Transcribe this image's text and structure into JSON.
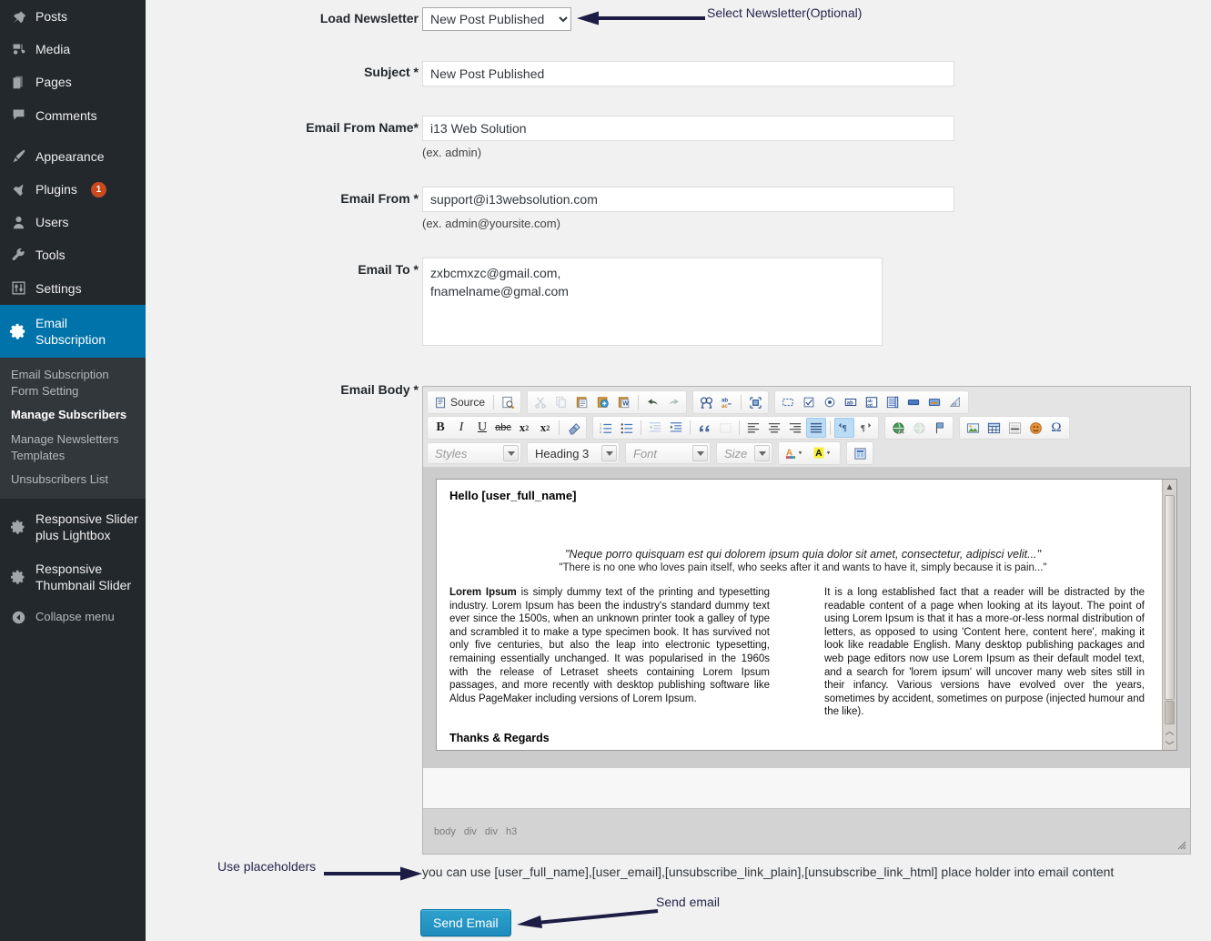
{
  "sidebar": {
    "items": [
      {
        "label": "Posts",
        "icon": "pin-icon"
      },
      {
        "label": "Media",
        "icon": "media-icon"
      },
      {
        "label": "Pages",
        "icon": "pages-icon"
      },
      {
        "label": "Comments",
        "icon": "comments-icon"
      },
      {
        "label": "Appearance",
        "icon": "brush-icon"
      },
      {
        "label": "Plugins",
        "icon": "plug-icon",
        "badge": "1"
      },
      {
        "label": "Users",
        "icon": "user-icon"
      },
      {
        "label": "Tools",
        "icon": "wrench-icon"
      },
      {
        "label": "Settings",
        "icon": "sliders-icon"
      },
      {
        "label": "Email\nSubscription",
        "icon": "gear-icon",
        "current": true
      }
    ],
    "submenu": [
      {
        "label": "Email Subscription\nForm Setting",
        "current": false
      },
      {
        "label": "Manage Subscribers",
        "current": true
      },
      {
        "label": "Manage Newsletters\nTemplates",
        "current": false
      },
      {
        "label": "Unsubscribers List",
        "current": false
      }
    ],
    "plugins_after": [
      {
        "label": "Responsive Slider\nplus Lightbox",
        "icon": "gear-icon"
      },
      {
        "label": "Responsive\nThumbnail Slider",
        "icon": "gear-icon"
      }
    ],
    "collapse": {
      "label": "Collapse menu",
      "icon": "collapse-icon"
    }
  },
  "form": {
    "load_newsletter": {
      "label": "Load Newsletter",
      "value": "New Post Published",
      "options": [
        "New Post Published"
      ]
    },
    "subject": {
      "label": "Subject *",
      "value": "New Post Published"
    },
    "email_from_name": {
      "label": "Email From Name*",
      "value": "i13 Web Solution",
      "hint": "(ex. admin)"
    },
    "email_from": {
      "label": "Email From *",
      "value": "support@i13websolution.com",
      "hint": "(ex. admin@yoursite.com)"
    },
    "email_to": {
      "label": "Email To *",
      "value": "zxbcmxzc@gmail.com,\nfnamelname@gmal.com"
    },
    "email_body": {
      "label": "Email Body *"
    }
  },
  "editor": {
    "toolbar_row1": [
      [
        {
          "name": "source-button",
          "label": "Source",
          "type": "text-btn"
        },
        {
          "name": "preview-icon",
          "label": "Preview"
        }
      ],
      [
        {
          "name": "cut-icon",
          "label": "Cut",
          "disabled": true
        },
        {
          "name": "copy-icon",
          "label": "Copy",
          "disabled": true
        },
        {
          "name": "paste-icon",
          "label": "Paste"
        },
        {
          "name": "paste-text-icon",
          "label": "Paste as plain text"
        },
        {
          "name": "paste-from-word-icon",
          "label": "Paste from Word"
        },
        {
          "name": "undo-icon",
          "label": "Undo"
        },
        {
          "name": "redo-icon",
          "label": "Redo",
          "disabled": true
        }
      ],
      [
        {
          "name": "find-icon",
          "label": "Find"
        },
        {
          "name": "replace-icon",
          "label": "Replace"
        },
        {
          "name": "select-all-icon",
          "label": "Select All"
        }
      ],
      [
        {
          "name": "form-icon",
          "label": "Form"
        },
        {
          "name": "checkbox-icon",
          "label": "Checkbox"
        },
        {
          "name": "radio-button-icon",
          "label": "Radio Button"
        },
        {
          "name": "text-field-icon",
          "label": "Text Field"
        },
        {
          "name": "textarea-icon",
          "label": "Textarea"
        },
        {
          "name": "select-field-icon",
          "label": "Selection Field"
        },
        {
          "name": "button-icon",
          "label": "Button"
        },
        {
          "name": "image-button-icon",
          "label": "Image Button"
        },
        {
          "name": "hidden-field-icon",
          "label": "Hidden Field"
        }
      ]
    ],
    "toolbar_row2": [
      [
        {
          "name": "bold-icon",
          "label": "Bold"
        },
        {
          "name": "italic-icon",
          "label": "Italic"
        },
        {
          "name": "underline-icon",
          "label": "Underline"
        },
        {
          "name": "strikethrough-icon",
          "label": "Strike Through"
        },
        {
          "name": "subscript-icon",
          "label": "Subscript"
        },
        {
          "name": "superscript-icon",
          "label": "Superscript"
        },
        {
          "name": "remove-format-icon",
          "label": "Remove Format"
        }
      ],
      [
        {
          "name": "numbered-list-icon",
          "label": "Insert/Remove Numbered List"
        },
        {
          "name": "bulleted-list-icon",
          "label": "Insert/Remove Bulleted List"
        },
        {
          "name": "outdent-icon",
          "label": "Decrease Indent",
          "disabled": true
        },
        {
          "name": "indent-icon",
          "label": "Increase Indent"
        },
        {
          "name": "blockquote-icon",
          "label": "Block Quote"
        },
        {
          "name": "create-div-icon",
          "label": "Create Div Container",
          "disabled": true
        },
        {
          "name": "align-left-icon",
          "label": "Align Left"
        },
        {
          "name": "align-center-icon",
          "label": "Center"
        },
        {
          "name": "align-right-icon",
          "label": "Align Right"
        },
        {
          "name": "justify-icon",
          "label": "Justify",
          "active": true
        },
        {
          "name": "text-direction-ltr-icon",
          "label": "Text direction left to right",
          "active": true
        },
        {
          "name": "text-direction-rtl-icon",
          "label": "Text direction right to left"
        }
      ],
      [
        {
          "name": "link-icon",
          "label": "Link"
        },
        {
          "name": "unlink-icon",
          "label": "Unlink",
          "disabled": true
        },
        {
          "name": "anchor-icon",
          "label": "Anchor"
        }
      ],
      [
        {
          "name": "image-icon",
          "label": "Image"
        },
        {
          "name": "table-icon",
          "label": "Table"
        },
        {
          "name": "horizontal-rule-icon",
          "label": "Horizontal Line"
        },
        {
          "name": "smiley-icon",
          "label": "Smiley"
        },
        {
          "name": "special-char-icon",
          "label": "Insert Special Character"
        }
      ]
    ],
    "combos": [
      {
        "name": "styles-combo",
        "label": "Styles",
        "placeholder": true
      },
      {
        "name": "format-combo",
        "label": "Heading 3",
        "placeholder": false
      },
      {
        "name": "font-combo",
        "label": "Font",
        "placeholder": true
      },
      {
        "name": "size-combo",
        "label": "Size",
        "placeholder": true
      }
    ],
    "color_buttons": [
      {
        "name": "text-color-icon",
        "label": "Text Color"
      },
      {
        "name": "bg-color-icon",
        "label": "Background Color"
      },
      {
        "name": "templates-icon",
        "label": "Templates"
      }
    ],
    "content": {
      "greeting": "Hello [user_full_name]",
      "quote_line1": "\"Neque porro quisquam est qui dolorem ipsum quia dolor sit amet, consectetur, adipisci velit...\"",
      "quote_line2": "\"There is no one who loves pain itself, who seeks after it and wants to have it, simply because it is pain...\"",
      "column_left_strong": "Lorem Ipsum",
      "column_left": " is simply dummy text of the printing and typesetting industry. Lorem Ipsum has been the industry's standard dummy text ever since the 1500s, when an unknown printer took a galley of type and scrambled it to make a type specimen book. It has survived not only five centuries, but also the leap into electronic typesetting, remaining essentially unchanged. It was popularised in the 1960s with the release of Letraset sheets containing Lorem Ipsum passages, and more recently with desktop publishing software like Aldus PageMaker including versions of Lorem Ipsum.",
      "column_right": "It is a long established fact that a reader will be distracted by the readable content of a page when looking at its layout. The point of using Lorem Ipsum is that it has a more-or-less normal distribution of letters, as opposed to using 'Content here, content here', making it look like readable English. Many desktop publishing packages and web page editors now use Lorem Ipsum as their default model text, and a search for 'lorem ipsum' will uncover many web sites still in their infancy. Various versions have evolved over the years, sometimes by accident, sometimes on purpose (injected humour and the like).",
      "closing": "Thanks & Regards"
    },
    "element_path": [
      "body",
      "div",
      "div",
      "h3"
    ]
  },
  "bottom": {
    "placeholder_note": "you can use [user_full_name],[user_email],[unsubscribe_link_plain],[unsubscribe_link_html] place holder into email content",
    "send_button": "Send Email"
  },
  "annotations": [
    {
      "name": "annotation-select-newsletter",
      "text": "Select Newsletter(Optional)"
    },
    {
      "name": "annotation-use-placeholders",
      "text": "Use placeholders"
    },
    {
      "name": "annotation-send-email",
      "text": "Send email"
    }
  ],
  "colors": {
    "sidebar_bg": "#23282d",
    "submenu_bg": "#32373c",
    "current_menu": "#0073aa",
    "page_bg": "#f1f1f1",
    "button_blue": "#2ea2cc",
    "badge_orange": "#ca4a1f",
    "annotation": "#26264f"
  }
}
